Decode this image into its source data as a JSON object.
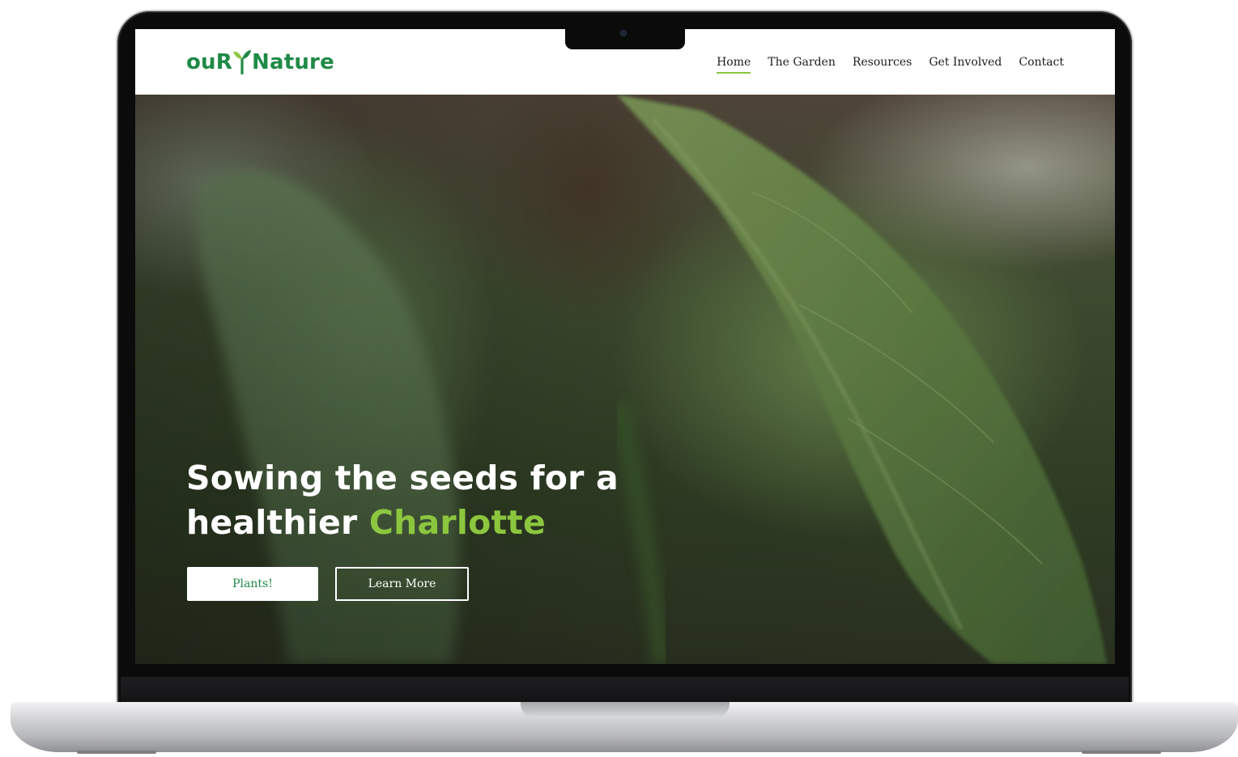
{
  "brand": {
    "logo_left": "ouR",
    "logo_right": "Nature",
    "logo_icon": "sprout-icon",
    "primary_color": "#1f8a47",
    "accent_color": "#8cc63f"
  },
  "nav": {
    "items": [
      {
        "label": "Home",
        "active": true
      },
      {
        "label": "The Garden",
        "active": false
      },
      {
        "label": "Resources",
        "active": false
      },
      {
        "label": "Get Involved",
        "active": false
      },
      {
        "label": "Contact",
        "active": false
      }
    ]
  },
  "hero": {
    "headline_line1": "Sowing the seeds for a",
    "headline_line2_start": "healthier",
    "headline_accent": "Charlotte",
    "primary_button": "Plants!",
    "secondary_button": "Learn More",
    "background": "blurred green leaf photo"
  }
}
